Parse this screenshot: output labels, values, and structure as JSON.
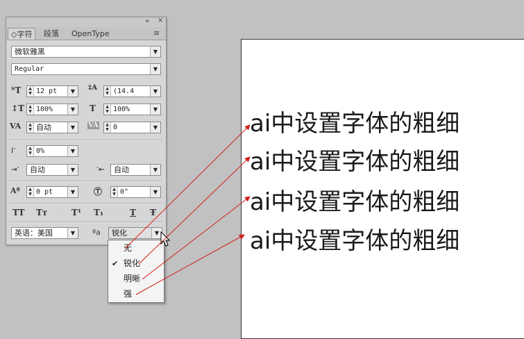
{
  "panel": {
    "window_controls": {
      "collapse": "«",
      "close": "×"
    },
    "tabs": [
      {
        "label": "◇字符",
        "active": true
      },
      {
        "label": "段落",
        "active": false
      },
      {
        "label": "OpenType",
        "active": false
      }
    ],
    "menu_icon": "≡",
    "font_family": "微软雅黑",
    "font_style": "Regular",
    "font_size": "12 pt",
    "leading": "(14.4",
    "vertical_scale": "100%",
    "horizontal_scale": "100%",
    "kerning": "自动",
    "tracking": "0",
    "tsume": "0%",
    "aki_left": "自动",
    "aki_right": "自动",
    "baseline_shift": "0 pt",
    "rotation": "0°",
    "format_buttons": [
      "TT",
      "Tт",
      "T¹",
      "T₁",
      "T",
      "Ŧ"
    ],
    "language": "英语：美国",
    "aa_label": "ªa",
    "antialias": "锐化"
  },
  "antialias_menu": {
    "items": [
      {
        "label": "无",
        "checked": false
      },
      {
        "label": "锐化",
        "checked": true
      },
      {
        "label": "明晰",
        "checked": false
      },
      {
        "label": "强",
        "checked": false
      }
    ],
    "check_glyph": "✔"
  },
  "canvas": {
    "lines": [
      "ai中设置字体的粗细",
      "ai中设置字体的粗细",
      "ai中设置字体的粗细",
      "ai中设置字体的粗细"
    ],
    "arrow_color": "#d0201a"
  }
}
